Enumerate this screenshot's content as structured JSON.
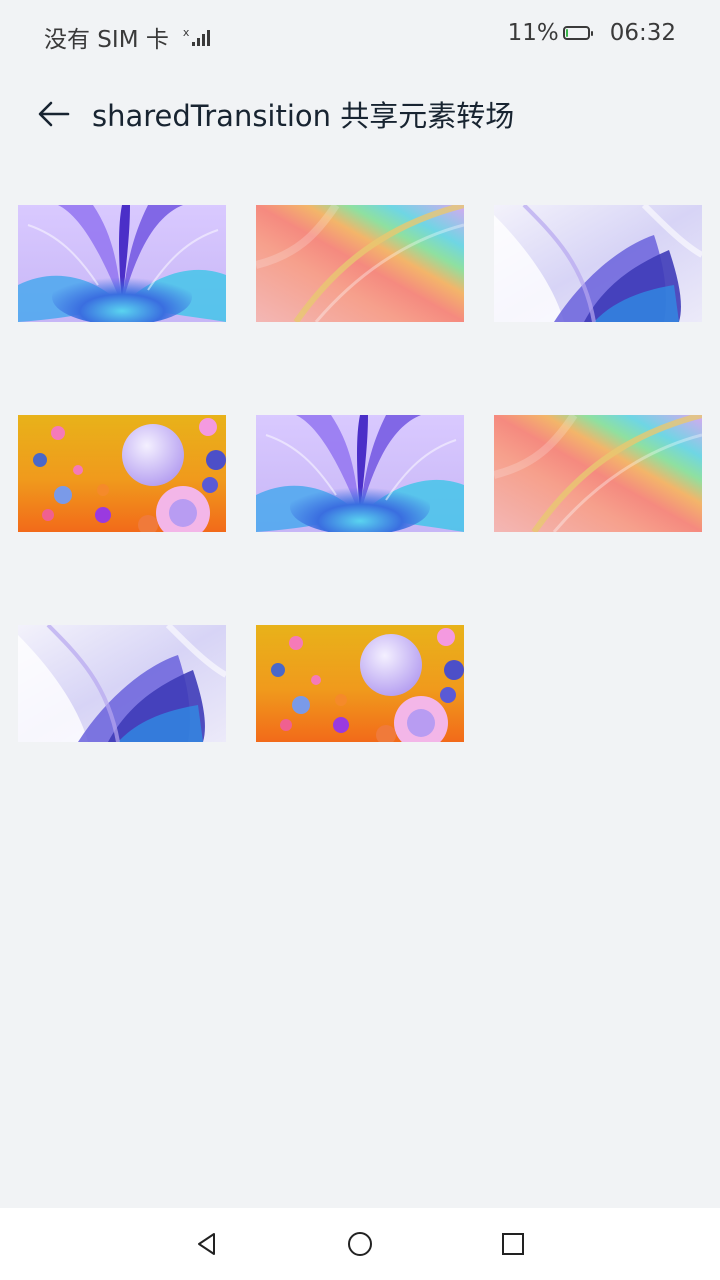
{
  "status_bar": {
    "carrier": "没有 SIM 卡",
    "battery_percent": "11%",
    "battery_level": 0.11,
    "time": "06:32"
  },
  "header": {
    "title": "sharedTransition 共享元素转场"
  },
  "colors": {
    "background": "#f1f3f5",
    "title_text": "#182431",
    "battery_fill": "#3bb54a"
  },
  "gallery": {
    "images": [
      {
        "art": "purple-blue-flower"
      },
      {
        "art": "rainbow-gradient"
      },
      {
        "art": "lavender-petals"
      },
      {
        "art": "orange-bubbles"
      },
      {
        "art": "purple-blue-flower"
      },
      {
        "art": "rainbow-gradient"
      },
      {
        "art": "lavender-petals"
      },
      {
        "art": "orange-bubbles"
      }
    ]
  },
  "nav": {
    "icons": [
      "back-triangle-icon",
      "home-circle-icon",
      "recents-square-icon"
    ]
  }
}
